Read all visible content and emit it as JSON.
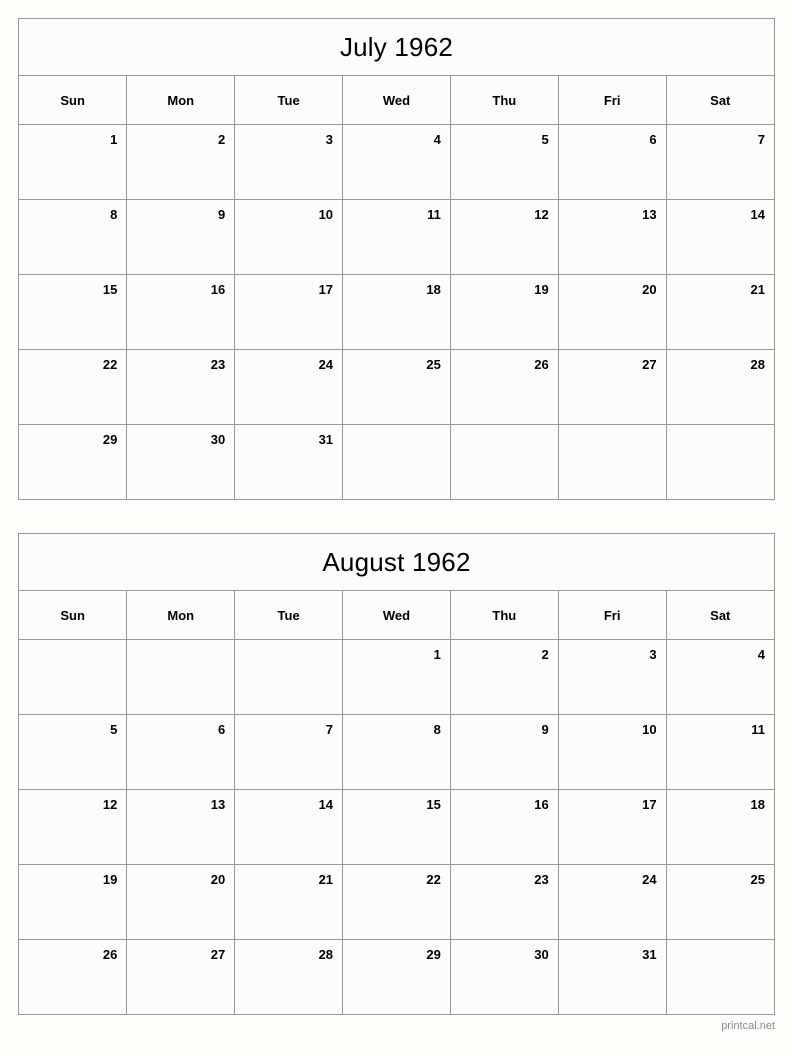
{
  "site": {
    "footer_credit": "printcal.net"
  },
  "theme": {
    "border_color": "#999999",
    "background_color": "#fcfdfa",
    "text_color": "#000000",
    "footer_text_color": "#8a8a8a"
  },
  "weekdays": [
    "Sun",
    "Mon",
    "Tue",
    "Wed",
    "Thu",
    "Fri",
    "Sat"
  ],
  "calendars": [
    {
      "id": "july-1962",
      "title": "July 1962",
      "month": "July",
      "year": "1962",
      "first_weekday_index": 0,
      "days_in_month": 31,
      "weeks": [
        [
          "1",
          "2",
          "3",
          "4",
          "5",
          "6",
          "7"
        ],
        [
          "8",
          "9",
          "10",
          "11",
          "12",
          "13",
          "14"
        ],
        [
          "15",
          "16",
          "17",
          "18",
          "19",
          "20",
          "21"
        ],
        [
          "22",
          "23",
          "24",
          "25",
          "26",
          "27",
          "28"
        ],
        [
          "29",
          "30",
          "31",
          "",
          "",
          "",
          ""
        ]
      ]
    },
    {
      "id": "august-1962",
      "title": "August 1962",
      "month": "August",
      "year": "1962",
      "first_weekday_index": 3,
      "days_in_month": 31,
      "weeks": [
        [
          "",
          "",
          "",
          "1",
          "2",
          "3",
          "4"
        ],
        [
          "5",
          "6",
          "7",
          "8",
          "9",
          "10",
          "11"
        ],
        [
          "12",
          "13",
          "14",
          "15",
          "16",
          "17",
          "18"
        ],
        [
          "19",
          "20",
          "21",
          "22",
          "23",
          "24",
          "25"
        ],
        [
          "26",
          "27",
          "28",
          "29",
          "30",
          "31",
          ""
        ]
      ]
    }
  ]
}
